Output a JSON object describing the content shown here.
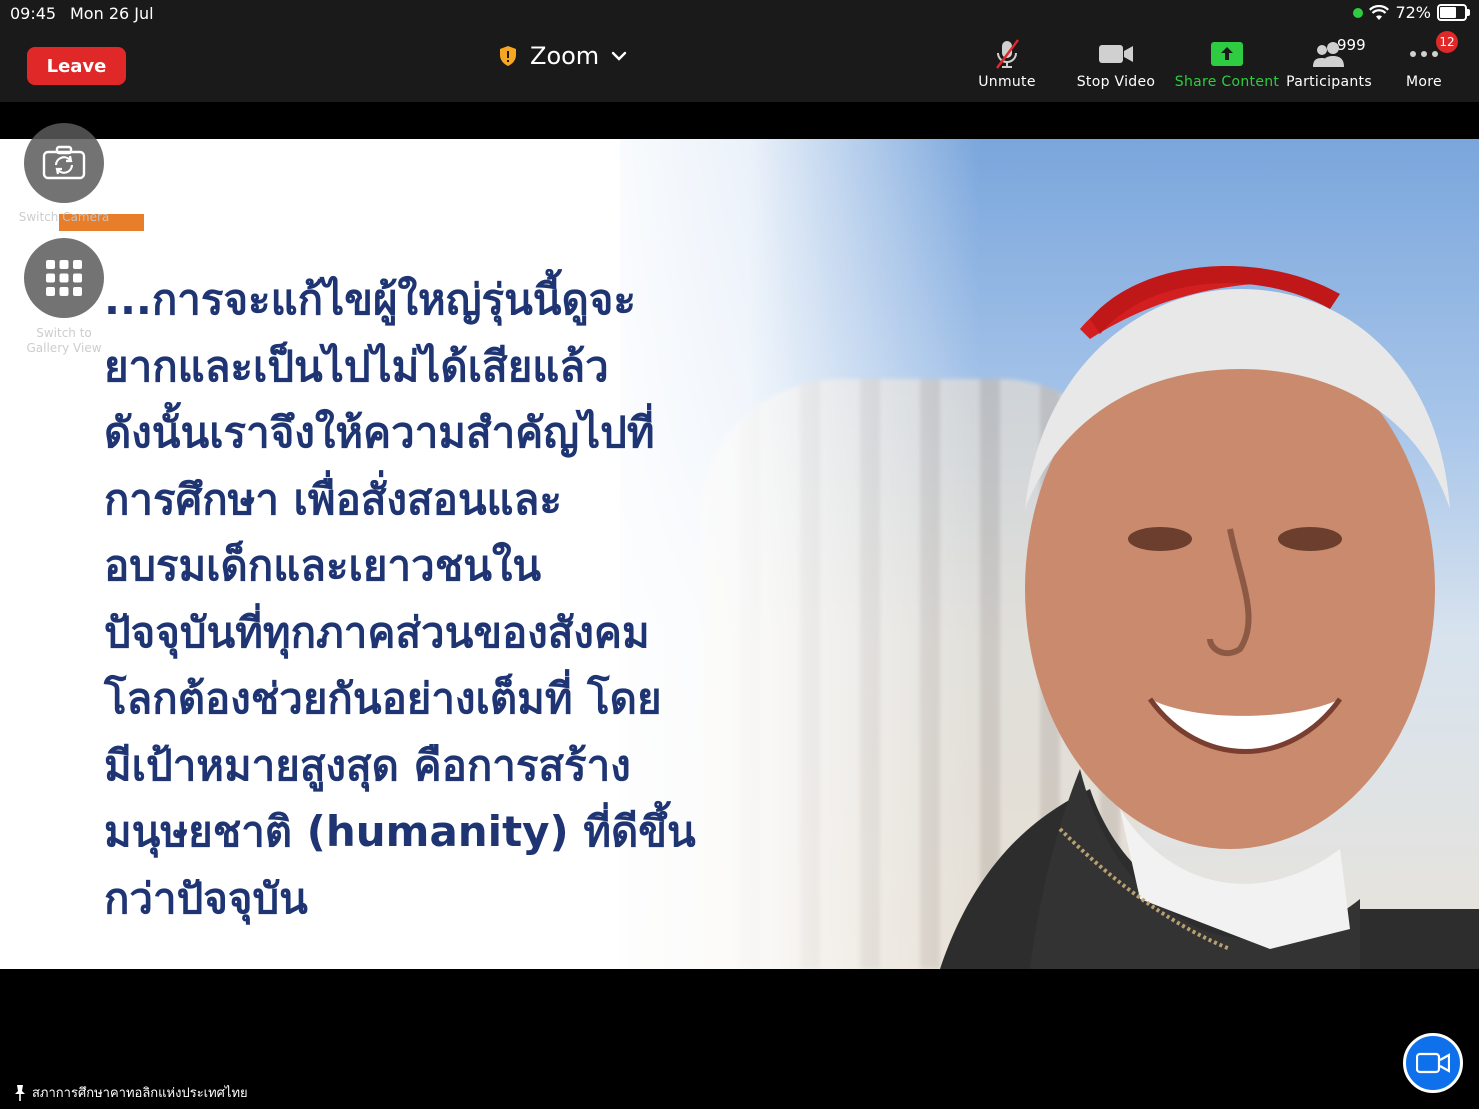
{
  "status_bar": {
    "time": "09:45",
    "date": "Mon 26 Jul",
    "battery_percent": "72%",
    "battery_level": 0.72
  },
  "toolbar": {
    "leave_label": "Leave",
    "meeting_title": "Zoom",
    "buttons": {
      "unmute": "Unmute",
      "stop_video": "Stop Video",
      "share_content": "Share Content",
      "participants": "Participants",
      "more": "More"
    },
    "participants_count": "999",
    "more_badge": "12"
  },
  "side_controls": {
    "switch_camera": "Switch Camera",
    "gallery_view_1": "Switch to",
    "gallery_view_2": "Gallery View"
  },
  "slide": {
    "lines": [
      "...การจะแก้ไขผู้ใหญ่รุ่นนี้ดูจะ",
      "ยากและเป็นไปไม่ได้เสียแล้ว",
      "ดังนั้นเราจึงให้ความสำคัญไปที่",
      "การศึกษา เพื่อสั่งสอนและ",
      "อบรมเด็กและเยาวชนใน",
      "ปัจจุบันที่ทุกภาคส่วนของสังคม",
      "โลกต้องช่วยกันอย่างเต็มที่ โดย",
      "มีเป้าหมายสูงสุด คือการสร้าง",
      "มนุษยชาติ (humanity) ที่ดีขึ้น",
      "กว่าปัจจุบัน"
    ]
  },
  "speaker_name": "สภาการศึกษาคาทอลิกแห่งประเทศไทย",
  "colors": {
    "leave": "#e02828",
    "share": "#2ecc40",
    "slide_text": "#1f3573",
    "float_button": "#0e71eb"
  },
  "icons": [
    "shield-icon",
    "chevron-down-icon",
    "muted-mic-icon",
    "video-camera-icon",
    "share-arrow-icon",
    "participants-icon",
    "more-dots-icon",
    "switch-camera-icon",
    "gallery-grid-icon",
    "pin-icon",
    "camera-float-icon",
    "wifi-icon",
    "battery-icon"
  ]
}
